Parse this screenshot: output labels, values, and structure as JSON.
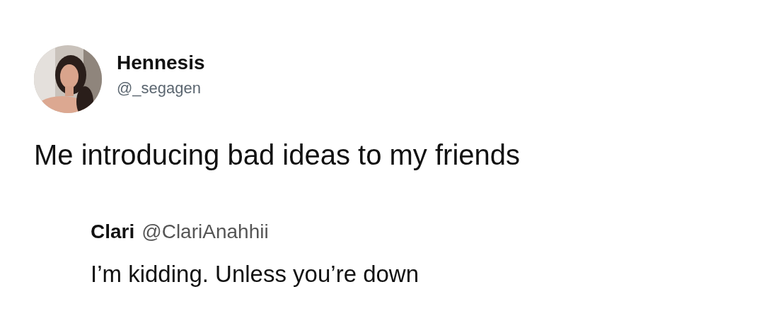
{
  "author": {
    "name": "Hennesis",
    "handle": "@_segagen"
  },
  "text": "Me introducing bad ideas to my friends",
  "quoted": {
    "name": "Clari",
    "handle": "@ClariAnahhii",
    "text": "I’m kidding. Unless you’re down"
  }
}
